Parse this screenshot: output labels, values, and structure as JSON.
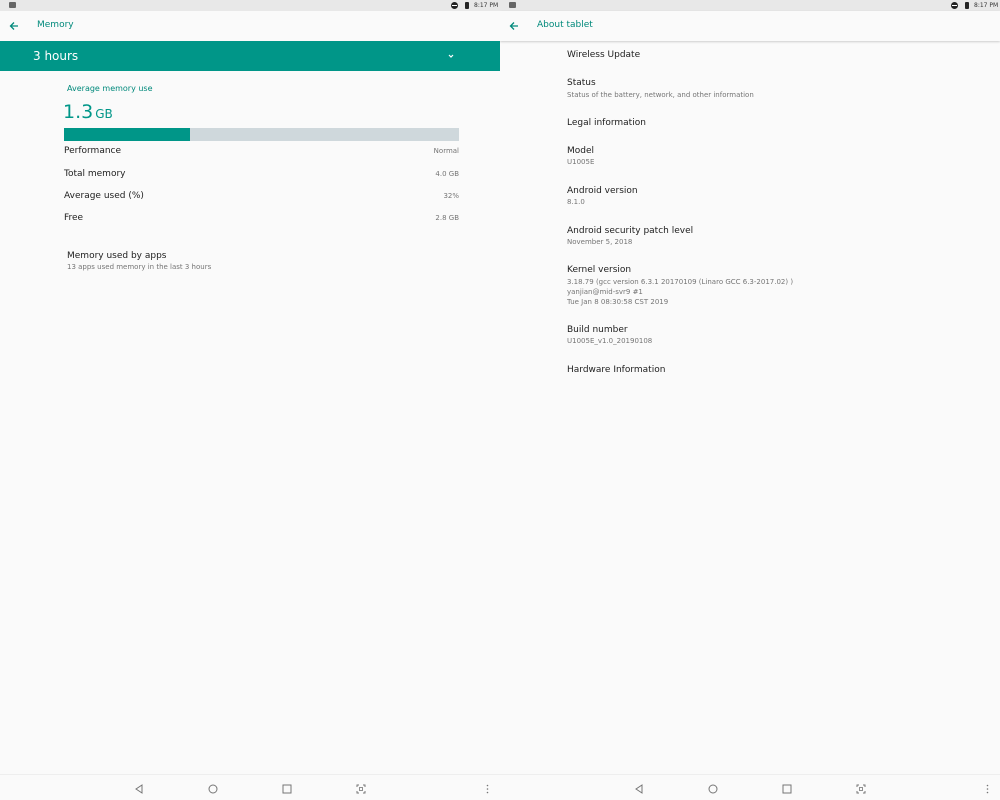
{
  "colors": {
    "accent": "#009688",
    "accent_text": "#00897b",
    "bar_track": "#cfd8dc",
    "background": "#fafafa"
  },
  "status_bar": {
    "time": "8:17 PM",
    "icons": [
      "photo-icon",
      "do-not-disturb-icon",
      "battery-icon"
    ]
  },
  "memory": {
    "title": "Memory",
    "period": "3 hours",
    "average_label": "Average memory use",
    "average_value": "1.3",
    "average_unit": "GB",
    "usage_fraction": 0.32,
    "stats": [
      {
        "label": "Performance",
        "value": "Normal"
      },
      {
        "label": "Total memory",
        "value": "4.0 GB"
      },
      {
        "label": "Average used (%)",
        "value": "32%"
      },
      {
        "label": "Free",
        "value": "2.8 GB"
      }
    ],
    "apps": {
      "title": "Memory used by apps",
      "subtitle": "13 apps used memory in the last 3 hours"
    }
  },
  "about": {
    "title": "About tablet",
    "items": [
      {
        "title": "Wireless Update",
        "lines": []
      },
      {
        "title": "Status",
        "lines": [
          "Status of the battery, network, and other information"
        ]
      },
      {
        "title": "Legal information",
        "lines": []
      },
      {
        "title": "Model",
        "lines": [
          "U1005E"
        ]
      },
      {
        "title": "Android version",
        "lines": [
          "8.1.0"
        ]
      },
      {
        "title": "Android security patch level",
        "lines": [
          "November 5, 2018"
        ]
      },
      {
        "title": "Kernel version",
        "lines": [
          "3.18.79 (gcc version 6.3.1 20170109 (Linaro GCC 6.3-2017.02) )",
          "yanjian@mid-svr9 #1",
          "Tue Jan 8 08:30:58 CST 2019"
        ]
      },
      {
        "title": "Build number",
        "lines": [
          "U1005E_v1.0_20190108"
        ]
      },
      {
        "title": "Hardware Information",
        "lines": []
      }
    ]
  },
  "nav_bar": {
    "buttons": [
      "back-icon",
      "home-icon",
      "recents-icon",
      "screenshot-icon",
      "more-icon"
    ]
  }
}
